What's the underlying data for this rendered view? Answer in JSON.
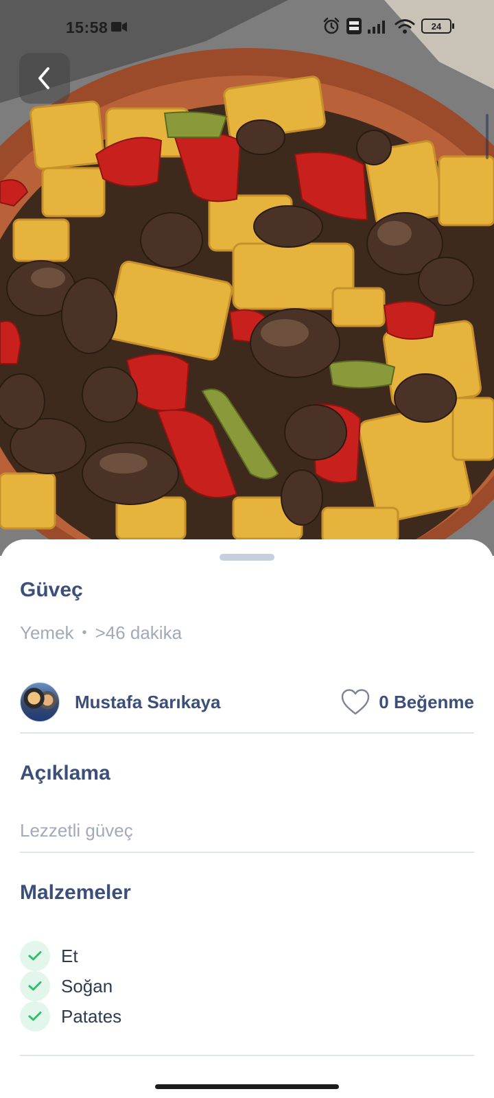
{
  "status_bar": {
    "time": "15:58",
    "battery": "24",
    "icons": [
      "video-record-icon",
      "alarm-icon",
      "volte-icon",
      "signal-icon",
      "wifi-icon",
      "battery-icon"
    ]
  },
  "hero": {
    "image": "food-photo"
  },
  "recipe": {
    "title": "Güveç",
    "category": "Yemek",
    "separator": "•",
    "duration": ">46 dakika"
  },
  "author": {
    "name": "Mustafa Sarıkaya",
    "likes_label": "0 Beğenme"
  },
  "description": {
    "heading": "Açıklama",
    "text": "Lezzetli güveç"
  },
  "ingredients": {
    "heading": "Malzemeler",
    "items": [
      {
        "label": "Et"
      },
      {
        "label": "Soğan"
      },
      {
        "label": "Patates"
      }
    ]
  },
  "colors": {
    "heading": "#3b4f7a",
    "muted": "#a2a9b8",
    "check_bg": "#e3f6ec",
    "check": "#2fbf71",
    "divider": "#dfe5ea"
  }
}
